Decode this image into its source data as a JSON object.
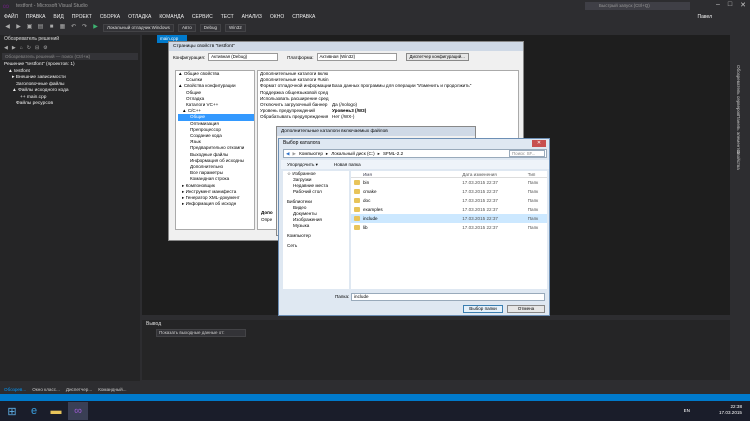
{
  "window": {
    "title": "testfont - Microsoft Visual Studio",
    "launch_placeholder": "Быстрый запуск (Ctrl+Q)",
    "user": "Павел"
  },
  "menu": [
    "ФАЙЛ",
    "ПРАВКА",
    "ВИД",
    "ПРОЕКТ",
    "СБОРКА",
    "ОТЛАДКА",
    "КОМАНДА",
    "СЕРВИС",
    "ТЕСТ",
    "АНАЛИЗ",
    "ОКНО",
    "СПРАВКА"
  ],
  "toolbar": {
    "debugger": "Локальный отладчик Windows",
    "auto": "Авто",
    "config": "Debug",
    "platform": "Win32"
  },
  "solution_explorer": {
    "title": "Обозреватель решений",
    "search_placeholder": "Обозреватель решений — поиск (Ctrl+ж)",
    "tree": [
      "Решение \"testfont\" (проектов: 1)",
      "▲ testfont",
      "▸ Внешние зависимости",
      "Заголовочные файлы",
      "▲ Файлы исходного кода",
      "++ main.cpp",
      "Файлы ресурсов"
    ]
  },
  "editor": {
    "tab": "main.cpp"
  },
  "right_strip": [
    "Обозреватель серверов",
    "Панель элементов",
    "Свойства"
  ],
  "output": {
    "title": "Вывод",
    "source_label": "Показать выходные данные от:"
  },
  "bottom_tabs": [
    "Обозрев...",
    "Окно класс...",
    "Диспетчер...",
    "Командный..."
  ],
  "properties_dialog": {
    "title": "Страницы свойств \"testfont\"",
    "config_label": "Конфигурация:",
    "config_value": "Активная (Debug)",
    "platform_label": "Платформа:",
    "platform_value": "Активная (Win32)",
    "config_manager": "Диспетчер конфигураций...",
    "tree": [
      "▲ Общие свойства",
      "Ссылки",
      "▲ Свойства конфигурации",
      "Общие",
      "Отладка",
      "Каталоги VC++",
      "▲ C/C++",
      "Общие",
      "Оптимизация",
      "Препроцессор",
      "Создание кода",
      "Язык",
      "Предварительно откомпи",
      "Выходные файлы",
      "Информация об исходны",
      "Дополнительно",
      "Все параметры",
      "Командная строка",
      "▸ Компоновщик",
      "▸ Инструмент манифеста",
      "▸ Генератор XML-документ",
      "▸ Информация об исходн"
    ],
    "tree_selected": 7,
    "grid": [
      [
        "Дополнительные каталоги вклю",
        ""
      ],
      [
        "Дополнительные каталоги #usin",
        ""
      ],
      [
        "Формат отладочной информации",
        "База данных программы для операции \"Изменить и продолжить\""
      ],
      [
        "Поддержка общеязыковой сред",
        ""
      ],
      [
        "Использовать расширение сред",
        ""
      ],
      [
        "Отключить загрузочный баннер",
        "Да (/nologo)"
      ],
      [
        "Уровень предупреждений",
        "Уровень3 (/W3)"
      ],
      [
        "Обрабатывать предупреждения",
        "Нет (/WX-)"
      ]
    ],
    "desc_label": "Допо",
    "desc_text": "Опре"
  },
  "include_dialog": {
    "title": "Дополнительные каталоги включаемых файлов"
  },
  "browse_dialog": {
    "title": "Выбор каталога",
    "path": [
      "Компьютер",
      "Локальный диск (C:)",
      "SFML-2.2"
    ],
    "search_placeholder": "Поиск: SF...",
    "organize": "Упорядочить ▾",
    "new_folder": "Новая папка",
    "nav": [
      "☆ Избранное",
      "Загрузки",
      "Недавние места",
      "Рабочий стол",
      "",
      "Библиотеки",
      "Видео",
      "Документы",
      "Изображения",
      "Музыка",
      "",
      "Компьютер",
      "",
      "Сеть"
    ],
    "columns": [
      "Имя",
      "Дата изменения",
      "Тип"
    ],
    "files": [
      [
        "bin",
        "17.03.2015 22:37",
        "Папк"
      ],
      [
        "cmake",
        "17.03.2015 22:37",
        "Папк"
      ],
      [
        "doc",
        "17.03.2015 22:37",
        "Папк"
      ],
      [
        "examples",
        "17.03.2015 22:37",
        "Папк"
      ],
      [
        "include",
        "17.03.2015 22:37",
        "Папк"
      ],
      [
        "lib",
        "17.03.2015 22:37",
        "Папк"
      ]
    ],
    "selected_index": 4,
    "folder_label": "Папка:",
    "folder_value": "include",
    "ok": "Выбор папки",
    "cancel": "Отмена"
  },
  "taskbar": {
    "lang": "EN",
    "time": "22:38",
    "date": "17.03.2015"
  }
}
